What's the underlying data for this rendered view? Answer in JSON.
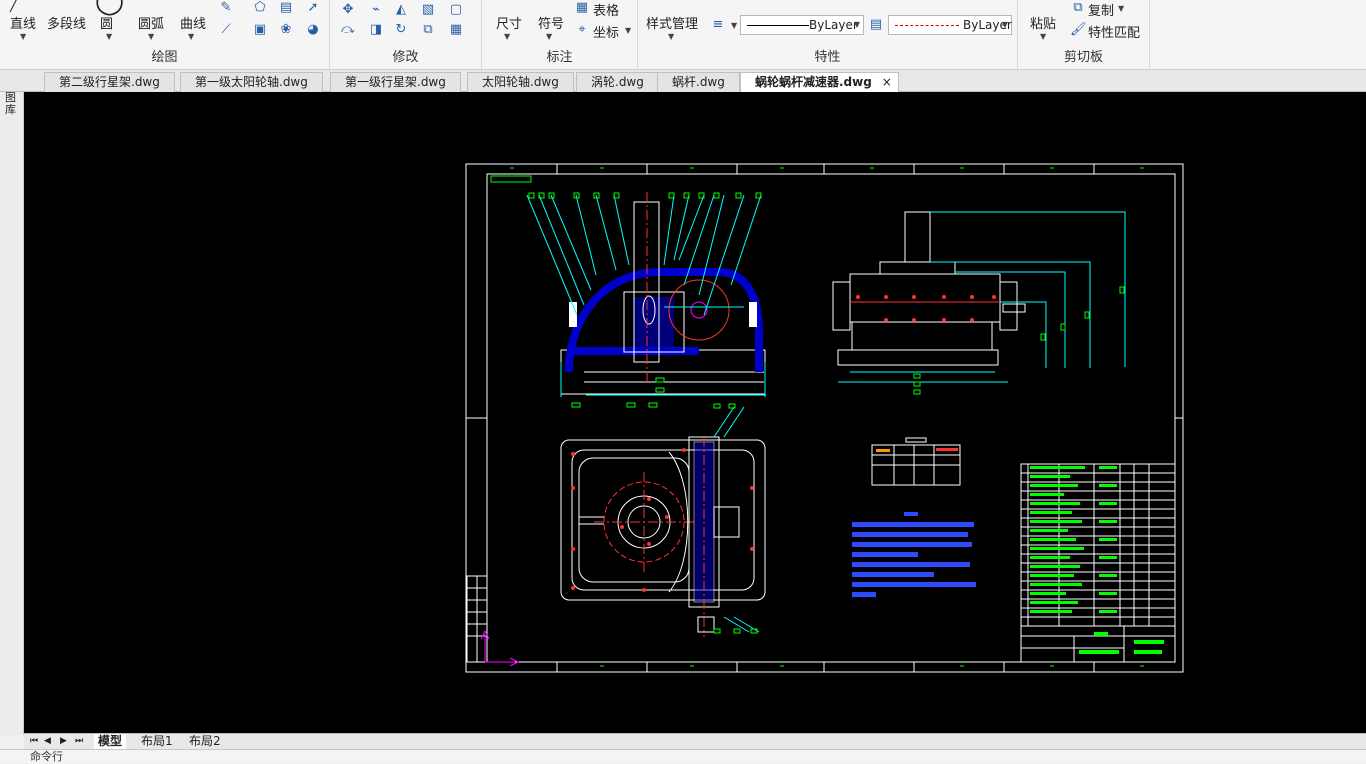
{
  "ribbon": {
    "draw_group": {
      "label": "绘图",
      "items": [
        "直线",
        "多段线",
        "圆",
        "圆弧",
        "曲线"
      ]
    },
    "modify_group": {
      "label": "修改"
    },
    "annotate_group": {
      "label": "标注",
      "items": [
        "尺寸",
        "符号",
        "表格",
        "坐标"
      ]
    },
    "properties_group": {
      "label": "特性",
      "style_manager": "样式管理",
      "linetype_value": "ByLayer",
      "lineweight_value": "ByLayer"
    },
    "clipboard_group": {
      "label": "剪切板",
      "paste": "粘贴",
      "copy": "复制",
      "match_props": "特性匹配"
    }
  },
  "tabs": [
    {
      "label": "第二级行星架.dwg",
      "active": false
    },
    {
      "label": "第一级太阳轮轴.dwg",
      "active": false
    },
    {
      "label": "第一级行星架.dwg",
      "active": false
    },
    {
      "label": "太阳轮轴.dwg",
      "active": false
    },
    {
      "label": "涡轮.dwg",
      "active": false
    },
    {
      "label": "蜗杆.dwg",
      "active": false
    },
    {
      "label": "蜗轮蜗杆减速器.dwg",
      "active": true
    }
  ],
  "tab_close": "×",
  "left_tool": {
    "label": "图库"
  },
  "layout_tabs": [
    "模型",
    "布局1",
    "布局2"
  ],
  "layout_nav": [
    "⏮",
    "◀",
    "▶",
    "⏭"
  ],
  "command_line": "命令行",
  "colors": {
    "canvas": "#000000",
    "frame": "#ffffff",
    "section_fill": "#0000cc",
    "leader": "#00ffff",
    "dim_green": "#00ff00",
    "red": "#ff3030",
    "magenta": "#ff00ff"
  }
}
